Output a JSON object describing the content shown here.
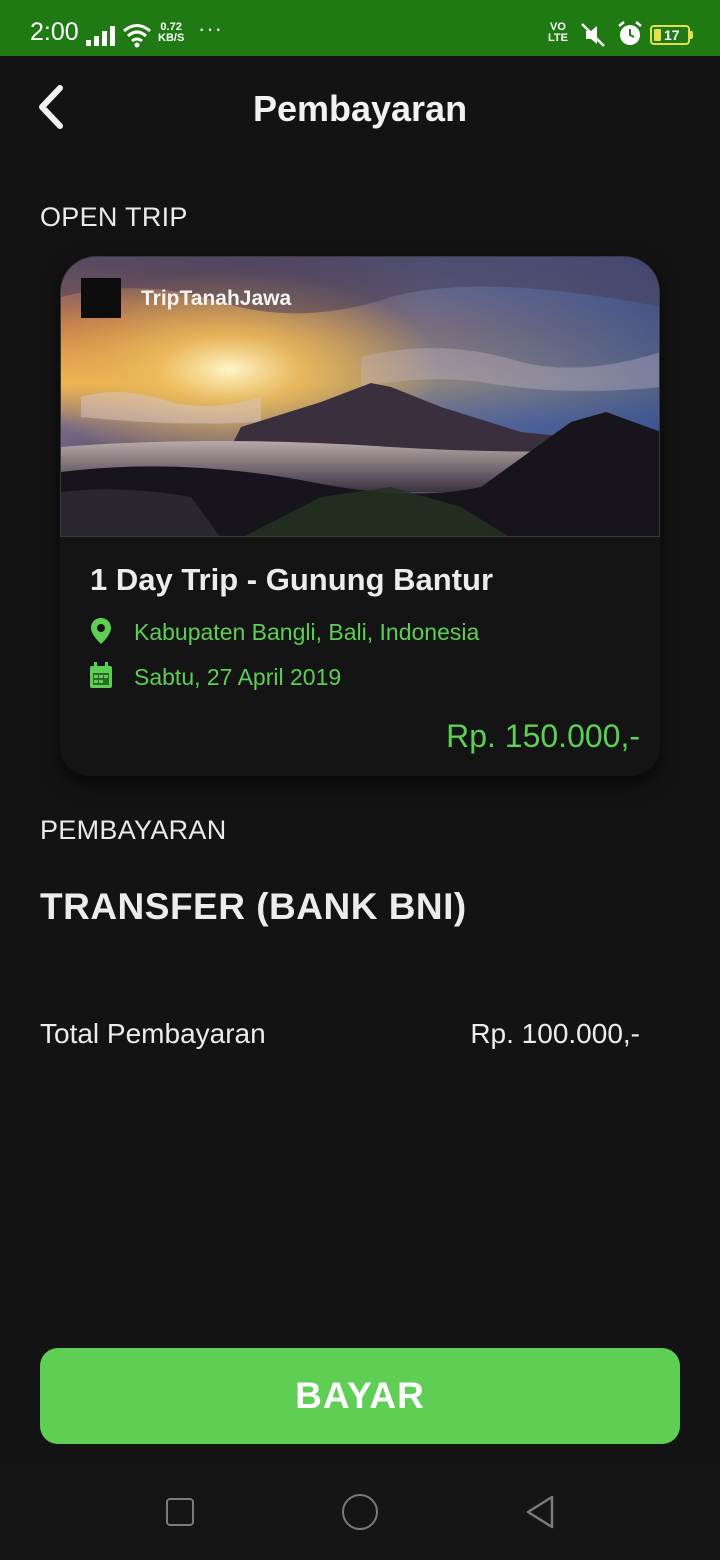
{
  "status_bar": {
    "time": "2:00",
    "net_speed_value": "0.72",
    "net_speed_unit": "KB/S",
    "more": "···",
    "volte_top": "VO",
    "volte_bottom": "LTE",
    "battery_level": "17",
    "icons": [
      "signal-icon",
      "wifi-icon",
      "mute-icon",
      "alarm-icon",
      "battery-icon"
    ]
  },
  "header": {
    "title": "Pembayaran",
    "back_icon": "chevron-left-icon"
  },
  "trip_section": {
    "label": "OPEN TRIP",
    "card": {
      "brand": "TripTanahJawa",
      "name": "1 Day Trip - Gunung Bantur",
      "location": "Kabupaten Bangli, Bali, Indonesia",
      "date": "Sabtu, 27 April 2019",
      "price": "Rp. 150.000,-",
      "location_icon": "map-pin-icon",
      "date_icon": "calendar-icon"
    }
  },
  "payment_section": {
    "label": "PEMBAYARAN",
    "method": "TRANSFER (BANK BNI)",
    "total_label": "Total Pembayaran",
    "total_value": "Rp. 100.000,-"
  },
  "pay_button": {
    "label": "BAYAR"
  },
  "colors": {
    "status_bar": "#1f7a14",
    "background": "#131313",
    "accent_green": "#5ece55",
    "battery": "#e4e04c"
  },
  "nav_bar": {
    "icons": [
      "recent-apps-icon",
      "home-icon",
      "back-icon"
    ]
  }
}
